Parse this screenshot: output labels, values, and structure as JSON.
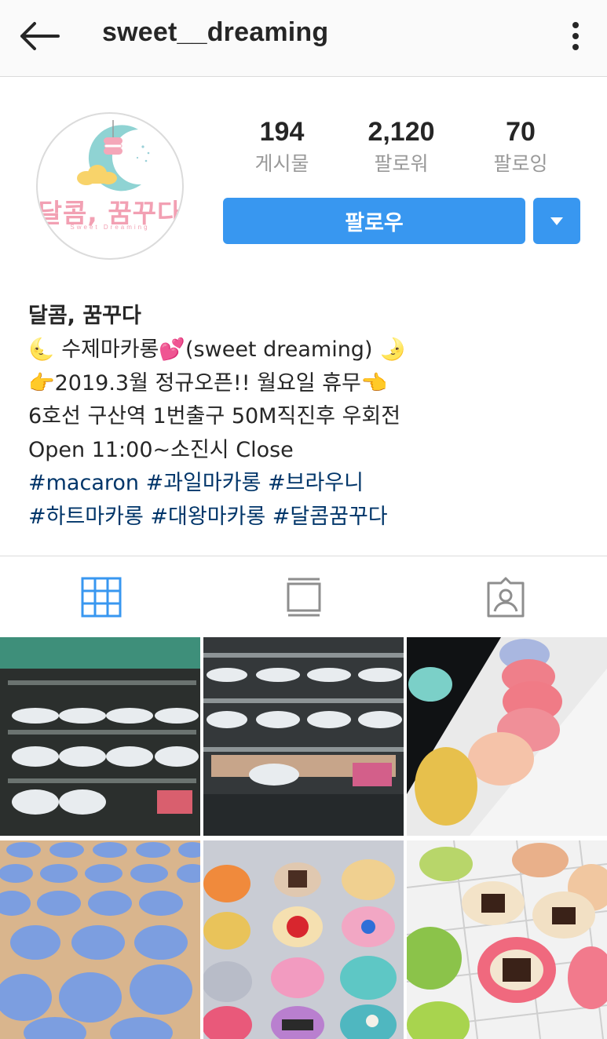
{
  "header": {
    "username": "sweet__dreaming",
    "back_icon": "back-arrow-icon",
    "more_icon": "more-vertical-icon"
  },
  "profile": {
    "avatar_name": "달콤, 꿈꾸다",
    "avatar_sub": "Sweet Dreaming"
  },
  "stats": [
    {
      "value": "194",
      "label": "게시물"
    },
    {
      "value": "2,120",
      "label": "팔로워"
    },
    {
      "value": "70",
      "label": "팔로잉"
    }
  ],
  "actions": {
    "follow_label": "팔로우",
    "dropdown_icon": "chevron-down-icon"
  },
  "bio": {
    "name": "달콤, 꿈꾸다",
    "line1": "🌜 수제마카롱💕(sweet dreaming) 🌛",
    "line2": "👉2019.3월 정규오픈!! 월요일 휴무👈",
    "line3": "6호선 구산역 1번출구 50M직진후 우회전",
    "line4": "Open 11:00~소진시 Close",
    "hashtags_line1": "#macaron #과일마카롱 #브라우니",
    "hashtags_line2": "#하트마카롱 #대왕마카롱 #달콤꿈꾸다"
  },
  "tabs": [
    {
      "name": "grid-icon",
      "active": true
    },
    {
      "name": "feed-icon",
      "active": false
    },
    {
      "name": "tagged-icon",
      "active": false
    }
  ],
  "colors": {
    "accent": "#3897f0",
    "hashtag": "#003569",
    "active_tab": "#3897f0",
    "inactive_tab": "#8e8e8e"
  }
}
